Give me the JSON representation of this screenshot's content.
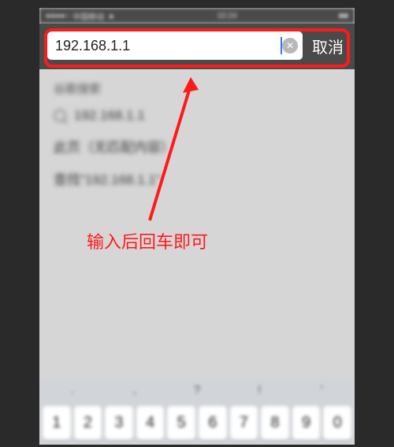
{
  "status": {
    "carrier": "中国移动",
    "time": "10:24"
  },
  "nav": {
    "url": "192.168.1.1",
    "clear_glyph": "✕",
    "cancel_label": "取消"
  },
  "suggestions": {
    "header": "谷歌搜索",
    "item1": "192.168.1.1",
    "item2": "此页（无匹配内容）",
    "item3": "查找\"192.168.1.1\""
  },
  "annotation": {
    "text": "输入后回车即可"
  },
  "keyboard": {
    "punct": [
      ".",
      ",",
      "?",
      "!",
      "'"
    ],
    "nums": [
      "1",
      "2",
      "3",
      "4",
      "5",
      "6",
      "7",
      "8",
      "9",
      "0"
    ]
  },
  "highlight_color": "#ff1a1a"
}
